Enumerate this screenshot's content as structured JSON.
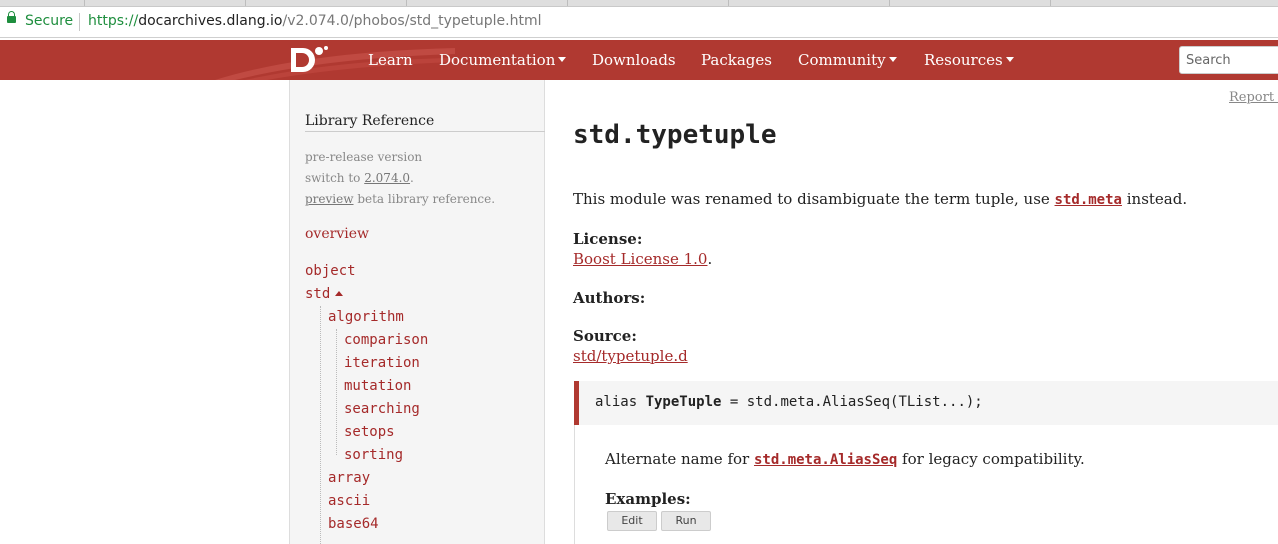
{
  "browser": {
    "secure_label": "Secure",
    "url_protocol": "https://",
    "url_host": "docarchives.dlang.io",
    "url_path": "/v2.074.0/phobos/std_typetuple.html"
  },
  "navbar": {
    "items": [
      "Learn",
      "Documentation",
      "Downloads",
      "Packages",
      "Community",
      "Resources"
    ],
    "search_placeholder": "Search",
    "brand_color": "#b03931"
  },
  "sidebar": {
    "title": "Library Reference",
    "note_line1": "pre-release version",
    "note_switch_prefix": "switch to ",
    "note_version_link": "2.074.0",
    "note_switch_suffix": ".",
    "note_preview_link": "preview",
    "note_preview_suffix": " beta library reference.",
    "overview": "overview",
    "object": "object",
    "std": "std",
    "algorithm": "algorithm",
    "algorithm_children": [
      "comparison",
      "iteration",
      "mutation",
      "searching",
      "setops",
      "sorting"
    ],
    "more_modules": [
      "array",
      "ascii",
      "base64"
    ]
  },
  "main": {
    "report_link": "Report a bug",
    "title": "std.typetuple",
    "intro_before": "This module was renamed to disambiguate the term tuple, use ",
    "intro_link": "std.meta",
    "intro_after": " instead.",
    "license_label": "License:",
    "license_link": "Boost License 1.0",
    "license_suffix": ".",
    "authors_label": "Authors:",
    "source_label": "Source:",
    "source_link": "std/typetuple.d",
    "decl_prefix": "alias ",
    "decl_name": "TypeTuple",
    "decl_rest": " = std.meta.AliasSeq(TList...);",
    "desc_before": "Alternate name for ",
    "desc_link": "std.meta.AliasSeq",
    "desc_after": " for legacy compatibility.",
    "examples_label": "Examples:",
    "edit_button": "Edit",
    "run_button": "Run"
  }
}
